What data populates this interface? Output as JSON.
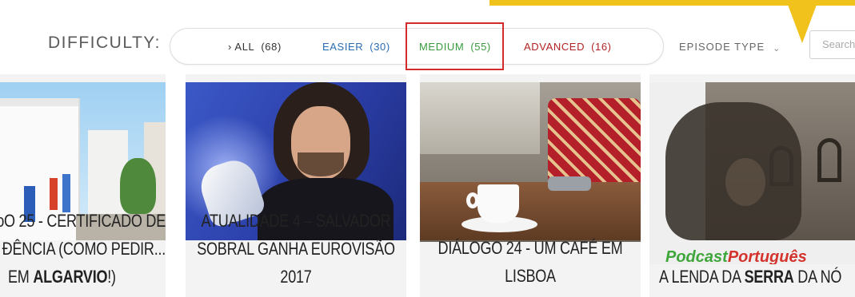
{
  "filter": {
    "label": "DIFFICULTY:",
    "options": [
      {
        "label": "› ALL",
        "count": "(68)",
        "color": "#333333"
      },
      {
        "label": "EASIER",
        "count": "(30)",
        "color": "#2b6cb0"
      },
      {
        "label": "MEDIUM",
        "count": "(55)",
        "color": "#3a9a3e"
      },
      {
        "label": "ADVANCED",
        "count": "(16)",
        "color": "#b22222"
      }
    ],
    "highlighted": "MEDIUM",
    "highlight_color": "#d42a2a"
  },
  "episode_type": {
    "label": "EPISODE TYPE",
    "icon": "chevron-down-icon"
  },
  "search": {
    "placeholder": "Search"
  },
  "callout_color": "#f1c21b",
  "cards": [
    {
      "title_lines": [
        "ɔO 25 - CERTIFICADO DE",
        "ĐÊNCIA (COMO PEDIR..."
      ],
      "last_line_parts": [
        "EM ",
        "ALGARVIO",
        "!)"
      ]
    },
    {
      "title_lines": [
        "ATUALIDADE 4 – SALVADOR",
        "SOBRAL GANHA EUROVISÃO",
        "2017"
      ]
    },
    {
      "title_lines": [
        "DIÁLOGO 24 - UM CAFÉ EM",
        "LISBOA"
      ]
    },
    {
      "title_parts": [
        "A LENDA DA ",
        "SERRA",
        " DA NÓ"
      ],
      "brand_parts": [
        "Podcast",
        "Português"
      ]
    }
  ]
}
